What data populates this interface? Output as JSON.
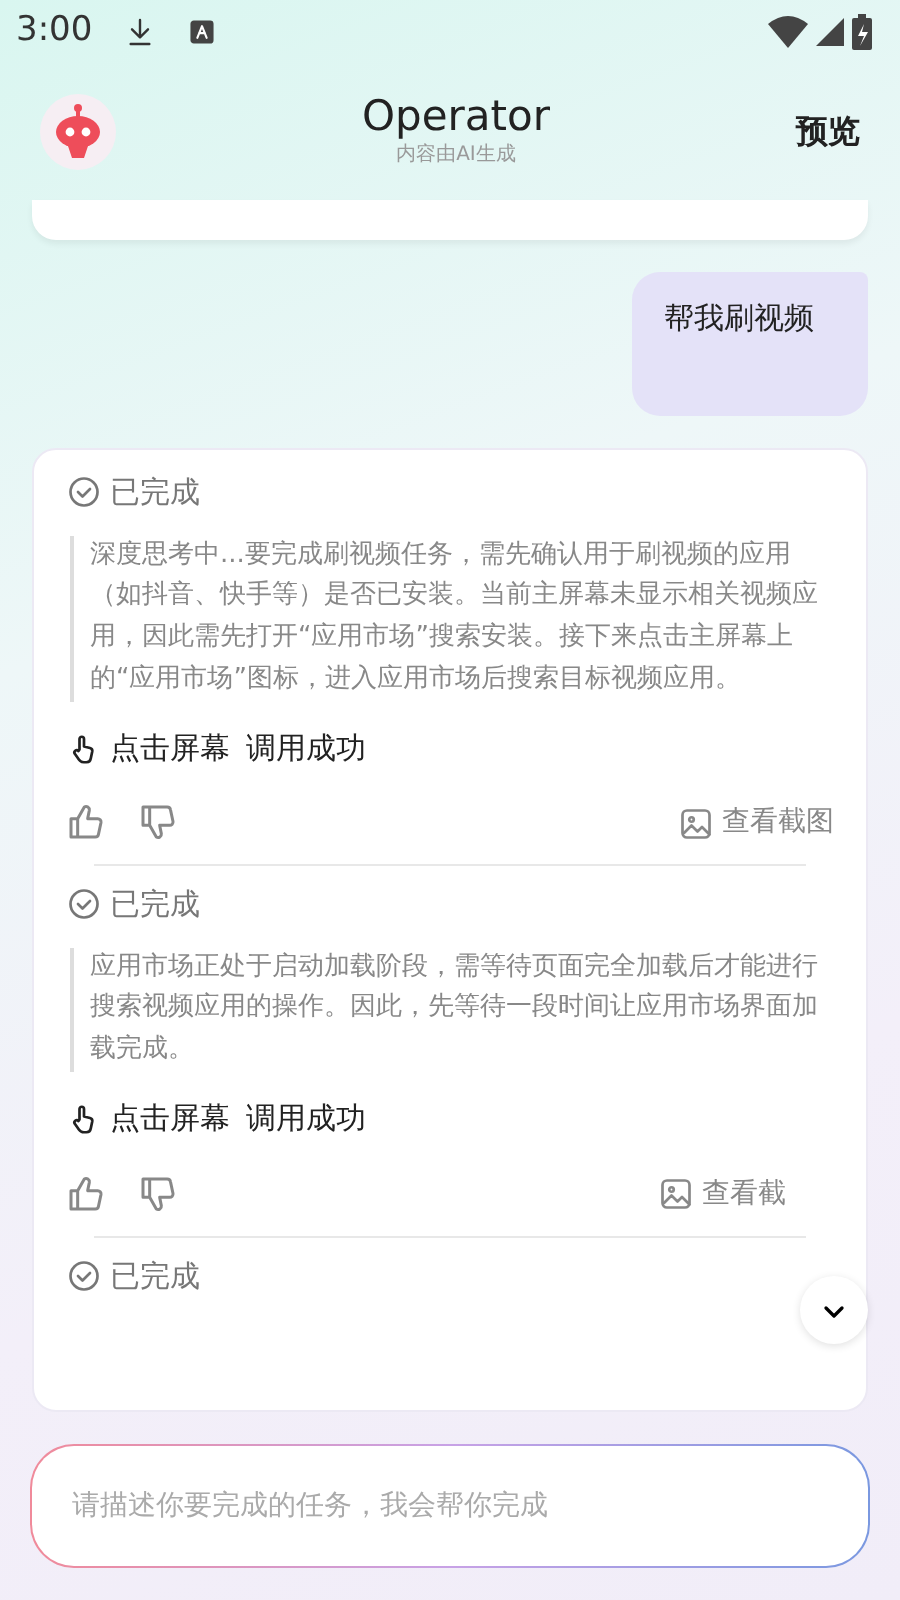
{
  "status_bar": {
    "time": "3:00"
  },
  "header": {
    "title": "Operator",
    "subtitle": "内容由AI生成",
    "action": "预览"
  },
  "messages": [
    {
      "kind": "user",
      "text": "帮我刷视频"
    }
  ],
  "steps": [
    {
      "status": "已完成",
      "thought": "深度思考中...要完成刷视频任务，需先确认用于刷视频的应用（如抖音、快手等）是否已安装。当前主屏幕未显示相关视频应用，因此需先打开“应用市场”搜索安装。接下来点击主屏幕上的“应用市场”图标，进入应用市场后搜索目标视频应用。",
      "action": "点击屏幕",
      "result": "调用成功",
      "screenshot_link": "查看截图"
    },
    {
      "status": "已完成",
      "thought": "应用市场正处于启动加载阶段，需等待页面完全加载后才能进行搜索视频应用的操作。因此，先等待一段时间让应用市场界面加载完成。",
      "action": "点击屏幕",
      "result": "调用成功",
      "screenshot_link": "查看截"
    },
    {
      "status": "已完成"
    }
  ],
  "input": {
    "placeholder": "请描述你要完成的任务，我会帮你完成"
  }
}
